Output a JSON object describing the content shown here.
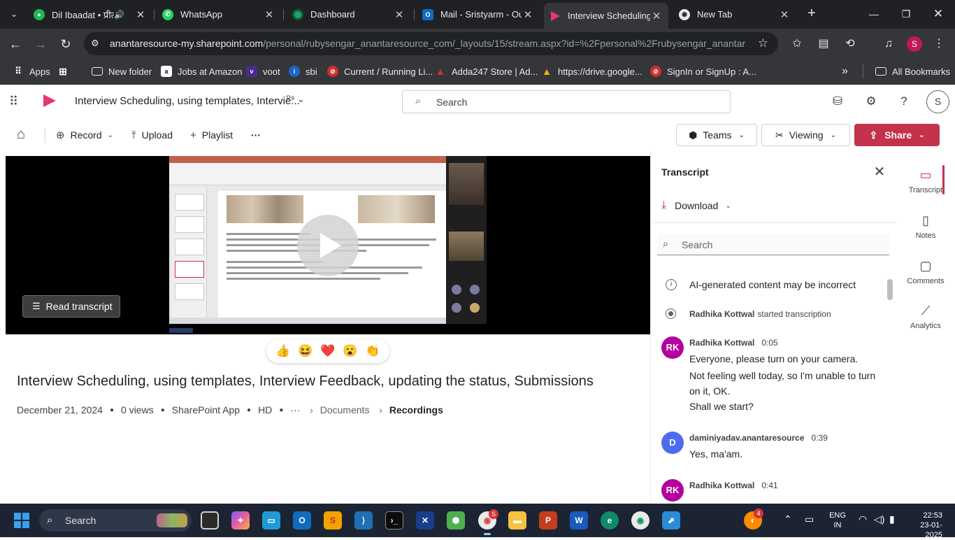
{
  "browser": {
    "tabs": [
      {
        "title": "Dil Ibaadat • प्रीत",
        "icon": "spotify-icon",
        "color": "#1db954"
      },
      {
        "title": "WhatsApp",
        "icon": "whatsapp-icon",
        "color": "#25d366"
      },
      {
        "title": "Dashboard",
        "icon": "dashboard-icon",
        "color": "#21a366"
      },
      {
        "title": "Mail - Sristyarm - Out",
        "icon": "outlook-icon",
        "color": "#0f6cbd"
      },
      {
        "title": "Interview Scheduling,",
        "icon": "stream-icon",
        "color": "#e8347a"
      },
      {
        "title": "New Tab",
        "icon": "chrome-icon",
        "color": "#e8eaed"
      }
    ],
    "url_host": "anantaresource-my.sharepoint.com",
    "url_path": "/personal/rubysengar_anantaresource_com/_layouts/15/stream.aspx?id=%2Fpersonal%2Frubysengar_anantare...",
    "profile_initial": "S",
    "bookmarks": [
      {
        "label": "Apps",
        "icon": "apps-grid-icon"
      },
      {
        "label": "New folder",
        "icon": "folder-icon"
      },
      {
        "label": "Jobs at Amazon",
        "icon": "amazon-icon"
      },
      {
        "label": "voot",
        "icon": "voot-icon"
      },
      {
        "label": "sbi",
        "icon": "sbi-icon"
      },
      {
        "label": "Current / Running Li...",
        "icon": "no-entry-icon"
      },
      {
        "label": "Adda247 Store | Ad...",
        "icon": "adda-icon"
      },
      {
        "label": "https://drive.google...",
        "icon": "drive-icon"
      },
      {
        "label": "SignIn or SignUp : A...",
        "icon": "no-entry-icon"
      }
    ],
    "all_bookmarks": "All Bookmarks"
  },
  "app": {
    "doc_title": "Interview Scheduling, using templates, Intervie...",
    "search_placeholder": "Search",
    "avatar_initial": "S"
  },
  "commands": {
    "record": "Record",
    "upload": "Upload",
    "playlist": "Playlist",
    "more": "···",
    "teams": "Teams",
    "viewing": "Viewing",
    "share": "Share"
  },
  "video": {
    "read_transcript": "Read transcript",
    "reactions": [
      "👍",
      "😆",
      "❤️",
      "😮",
      "👏"
    ],
    "title": "Interview Scheduling, using templates, Interview Feedback, updating the status, Submissions",
    "date": "December 21, 2024",
    "views": "0 views",
    "app": "SharePoint App",
    "quality": "HD",
    "more": "···",
    "breadcrumb": [
      "Documents",
      "Recordings"
    ]
  },
  "transcript": {
    "title": "Transcript",
    "download": "Download",
    "search_placeholder": "Search",
    "ai_note": "AI-generated content may be incorrect",
    "started_by": "Radhika Kottwal",
    "started_text": "started transcription",
    "entries": [
      {
        "initials": "RK",
        "speaker": "Radhika Kottwal",
        "time": "0:05",
        "color": "#b4009e",
        "lines": [
          "Everyone, please turn on your camera.",
          "Not feeling well today, so I'm unable to turn on it, OK.",
          "Shall we start?"
        ]
      },
      {
        "initials": "D",
        "speaker": "daminiyadav.anantaresource",
        "time": "0:39",
        "color": "#4f6bed",
        "lines": [
          "Yes, ma'am."
        ]
      },
      {
        "initials": "RK",
        "speaker": "Radhika Kottwal",
        "time": "0:41",
        "color": "#b4009e",
        "lines": []
      }
    ]
  },
  "rail": [
    {
      "label": "Transcript",
      "icon": "transcript-icon"
    },
    {
      "label": "Notes",
      "icon": "notes-icon"
    },
    {
      "label": "Comments",
      "icon": "comments-icon"
    },
    {
      "label": "Analytics",
      "icon": "analytics-icon"
    }
  ],
  "taskbar": {
    "search_placeholder": "Search",
    "chrome_badge": "S",
    "weather_badge": "4",
    "lang_top": "ENG",
    "lang_bottom": "IN",
    "time": "22:53",
    "date": "23-01-2025"
  }
}
